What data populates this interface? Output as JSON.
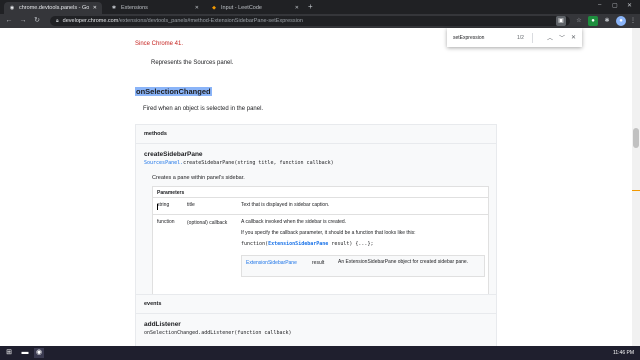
{
  "browser": {
    "tabs": [
      {
        "label": "chrome.devtools.panels - Google",
        "icon": "chrome-icon",
        "active": true
      },
      {
        "label": "Extensions",
        "icon": "puzzle-icon",
        "active": false
      },
      {
        "label": "Input - LeetCode",
        "icon": "leetcode-icon",
        "active": false
      }
    ],
    "url_host": "developer.chrome.com",
    "url_path": "/extensions/devtools_panels#method-ExtensionSidebarPane-setExpression"
  },
  "findbar": {
    "query": "setExpression",
    "count": "1/2"
  },
  "page": {
    "since": "Since Chrome 41.",
    "represents": "Represents the Sources panel.",
    "event_name": "onSelectionChanged",
    "event_desc": "Fired when an object is selected in the panel.",
    "methods_label": "methods",
    "method_name": "createSidebarPane",
    "method_sig_prefix": "SourcesPanel.",
    "method_sig_rest": "createSidebarPane(string title, function callback)",
    "method_desc": "Creates a pane within panel's sidebar.",
    "params_label": "Parameters",
    "params": [
      {
        "type": "string",
        "name": "title",
        "desc": "Text that is displayed in sidebar caption."
      },
      {
        "type": "function",
        "name": "(optional) callback",
        "desc": "A callback invoked when the sidebar is created."
      }
    ],
    "callback_note": "If you specify the callback parameter, it should be a function that looks like this:",
    "callback_code_prefix": "function(",
    "callback_code_type": "ExtensionSidebarPane",
    "callback_code_suffix": " result) {...};",
    "sub_type": "ExtensionSidebarPane",
    "sub_name": "result",
    "sub_desc": "An ExtensionSidebarPane object for created sidebar pane.",
    "events_label": "events",
    "event2_name": "addListener",
    "event2_sig": "onSelectionChanged.addListener(function callback)"
  },
  "taskbar": {
    "time": "11:46 PM"
  },
  "colors": {
    "highlight": "#8ab4f8",
    "since_red": "#c5221f",
    "link_blue": "#1a73e8"
  }
}
